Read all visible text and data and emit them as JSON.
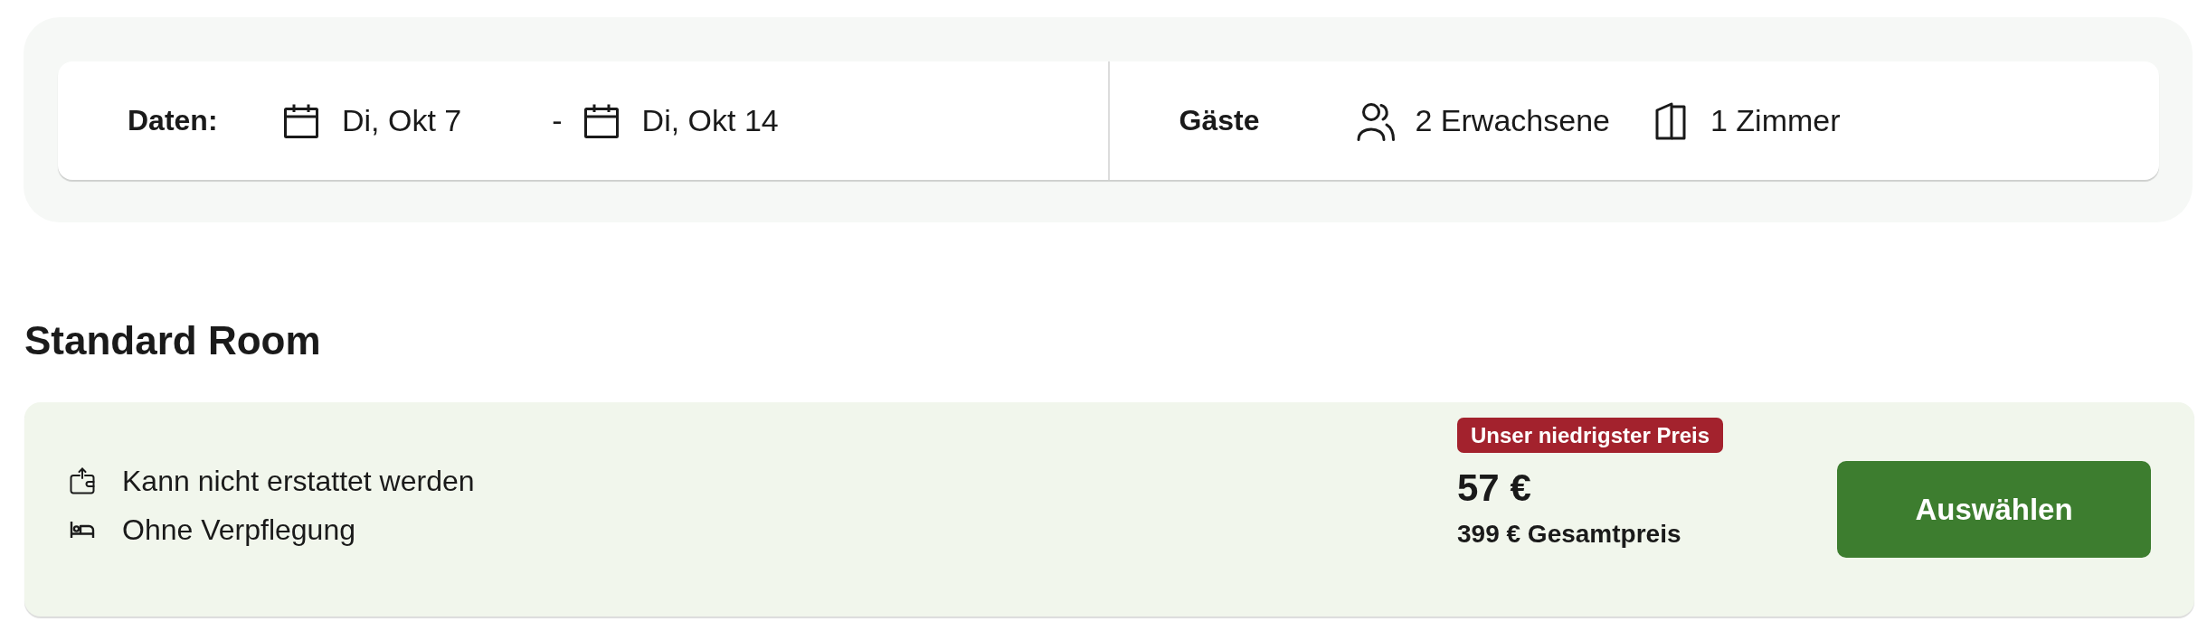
{
  "search_bar": {
    "dates": {
      "label": "Daten:",
      "check_in": "Di, Okt 7",
      "separator": "-",
      "check_out": "Di, Okt 14"
    },
    "guests": {
      "label": "Gäste",
      "adults": "2 Erwachsene",
      "rooms": "1 Zimmer"
    }
  },
  "room": {
    "title": "Standard Room",
    "rate": {
      "features": [
        {
          "kind": "refund",
          "text": "Kann nicht erstattet werden"
        },
        {
          "kind": "meal",
          "text": "Ohne Verpflegung"
        }
      ],
      "badge": "Unser niedrigster Preis",
      "price": "57 €",
      "total": "399 € Gesamtpreis",
      "button": "Auswählen"
    }
  }
}
